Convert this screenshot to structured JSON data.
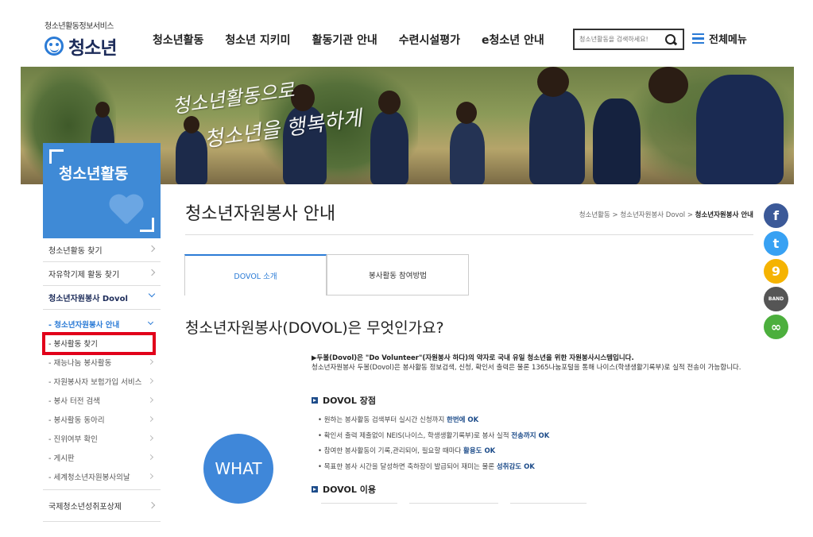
{
  "header": {
    "logo_sub": "청소년활동정보서비스",
    "logo_name": "청소년",
    "nav": [
      "청소년활동",
      "청소년 지키미",
      "활동기관 안내",
      "수련시설평가",
      "e청소년 안내"
    ],
    "search_placeholder": "청소년활동을 검색하세요!",
    "all_menu_label": "전체메뉴"
  },
  "banner": {
    "text_line1": "청소년활동으로",
    "text_line2": "청소년을 행복하게"
  },
  "section": {
    "title": "청소년활동"
  },
  "sidebar": {
    "items": [
      {
        "label": "청소년활동 찾기"
      },
      {
        "label": "자유학기제 활동 찾기"
      },
      {
        "label": "청소년자원봉사 Dovol"
      }
    ],
    "sub_items": [
      {
        "label": "- 청소년자원봉사 안내"
      },
      {
        "label": "- 봉사활동 찾기"
      },
      {
        "label": "- 재능나눔 봉사활동"
      },
      {
        "label": "- 자원봉사자 보험가입 서비스"
      },
      {
        "label": "- 봉사 터전 검색"
      },
      {
        "label": "- 봉사활동 동아리"
      },
      {
        "label": "- 진위여부 확인"
      },
      {
        "label": "- 게시판"
      },
      {
        "label": "- 세계청소년자원봉사의날"
      }
    ],
    "bottom_item": {
      "label": "국제청소년성취포상제"
    }
  },
  "content": {
    "page_title": "청소년자원봉사 안내",
    "breadcrumb_prefix": "청소년활동 > 청소년자원봉사 Dovol > ",
    "breadcrumb_current": "청소년자원봉사 안내",
    "tabs": [
      "DOVOL 소개",
      "봉사활동 참여방법"
    ],
    "heading": "청소년자원봉사(DOVOL)은 무엇인가요?",
    "what_label": "WHAT",
    "lead": "▶두볼(Dovol)은 \"Do Volunteer\"(자원봉사 하다)의 약자로 국내 유일 청소년을 위한 자원봉사시스템입니다.",
    "lead_detail": "청소년자원봉사 두볼(Dovol)은 봉사활동 정보검색, 신청, 확인서 출력은 물론 1365나눔포털을 통해 나이스(학생생활기록부)로 실적 전송이 가능합니다.",
    "merits_title": "DOVOL 장점",
    "merits": [
      {
        "text": "• 원하는 봉사활동 검색부터 실시간 신청까지 ",
        "em": "한번에 OK"
      },
      {
        "text": "• 확인서 출력 제출없이 NEIS(나이스, 학생생활기록부)로 봉사 실적 ",
        "em": "전송까지 OK"
      },
      {
        "text": "• 참여한 봉사활동이 기록,관리되어, 필요할 때마다 ",
        "em": "활용도 OK"
      },
      {
        "text": "• 목표한 봉사 시간을 달성하면 축하장이 발급되어 재미는 물론 ",
        "em": "성취감도 OK"
      }
    ],
    "use_title": "DOVOL 이용"
  },
  "social": [
    {
      "name": "facebook",
      "glyph": "f",
      "color": "#3b5998"
    },
    {
      "name": "twitter",
      "glyph": "t",
      "color": "#38a1f3"
    },
    {
      "name": "kakaostory",
      "glyph": "9",
      "color": "#f5b301"
    },
    {
      "name": "band",
      "glyph": "BAND",
      "color": "#555555"
    },
    {
      "name": "link",
      "glyph": "∞",
      "color": "#4caf3d"
    }
  ]
}
